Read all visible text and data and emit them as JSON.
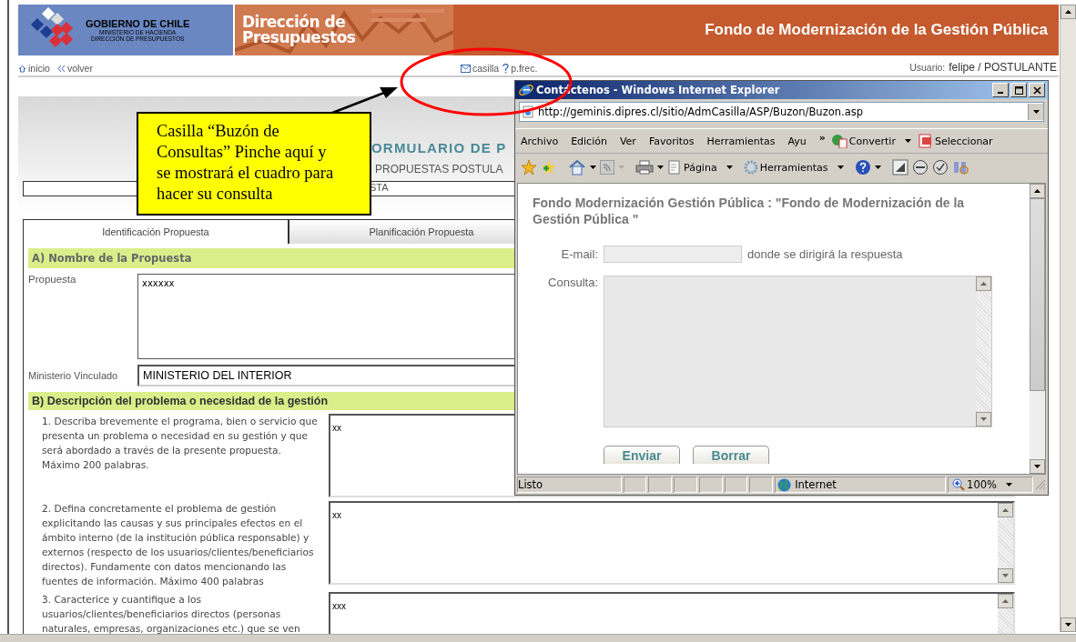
{
  "header": {
    "org_name": "GOBIERNO DE CHILE",
    "org_sub": [
      "MINISTERIO DE HACIENDA",
      "DIRECCIÓN DE PRESUPUESTOS"
    ],
    "banner": [
      "Dirección de",
      "Presupuestos"
    ],
    "title": "Fondo de Modernización de la Gestión Pública"
  },
  "nav": {
    "links": [
      {
        "label": "inicio",
        "kind": "home"
      },
      {
        "label": "volver",
        "kind": "back"
      }
    ],
    "help_links": [
      {
        "label": "casilla",
        "kind": "mail"
      },
      {
        "label": "p.frec.",
        "kind": "help"
      }
    ],
    "user_label": "Usuario:",
    "user": "felipe / POSTULANTE"
  },
  "form": {
    "title": "ORMULARIO DE P",
    "subtitle": "PROPUESTAS POSTULA",
    "status_field": "STA",
    "tabs": [
      {
        "label": "Identificación Propuesta",
        "selected": true
      },
      {
        "label": "Planificación Propuesta",
        "selected": false
      }
    ],
    "section_a": {
      "heading": "A) Nombre de la Propuesta",
      "fields": [
        {
          "label": "Propuesta",
          "value": "xxxxxx",
          "kind": "textarea"
        },
        {
          "label": "Ministerio Vinculado",
          "value": "MINISTERIO DEL INTERIOR",
          "kind": "input"
        }
      ]
    },
    "section_b": {
      "heading": "B) Descripción del problema o necesidad de la gestión",
      "questions": [
        {
          "text": "1. Describa brevemente el programa, bien o servicio que presenta un problema o necesidad en su gestión y que será abordado a través de la presente propuesta. Máximo 200 palabras.",
          "answer": "xx"
        },
        {
          "text": "2. Defina concretamente el problema de gestión explicitando las causas y sus principales efectos en el ámbito interno (de la institución pública responsable) y externos (respecto de los usuarios/clientes/beneficiarios directos). Fundamente con datos mencionando las fuentes de información. Máximo 400 palabras",
          "answer": "xx"
        },
        {
          "text": "3. Caracterice y cuantifique a los usuarios/clientes/beneficiarios directos (personas naturales, empresas, organizaciones etc.) que se ven",
          "answer": "xxx"
        }
      ]
    }
  },
  "callout": {
    "text": "Casilla “Buzón de Consultas” Pinche aquí y se mostrará el cuadro para hacer su consulta"
  },
  "popup": {
    "title": "Contáctenos - Windows Internet Explorer",
    "address": "http://geminis.dipres.cl/sitio/AdmCasilla/ASP/Buzon/Buzon.asp",
    "menu": [
      "Archivo",
      "Edición",
      "Ver",
      "Favoritos",
      "Herramientas",
      "Ayu"
    ],
    "menu_more": "»",
    "tools": [
      "Convertir",
      "Seleccionar"
    ],
    "commands": [
      "Página",
      "Herramientas"
    ],
    "heading": "Fondo Modernización Gestión Pública : \"Fondo de Modernización de la Gestión Pública \"",
    "email_label": "E-mail:",
    "email_hint": "donde se dirigirá la respuesta",
    "query_label": "Consulta:",
    "buttons": [
      "Enviar",
      "Borrar"
    ],
    "status": "Listo",
    "zone": "Internet",
    "zoom": "100%"
  }
}
